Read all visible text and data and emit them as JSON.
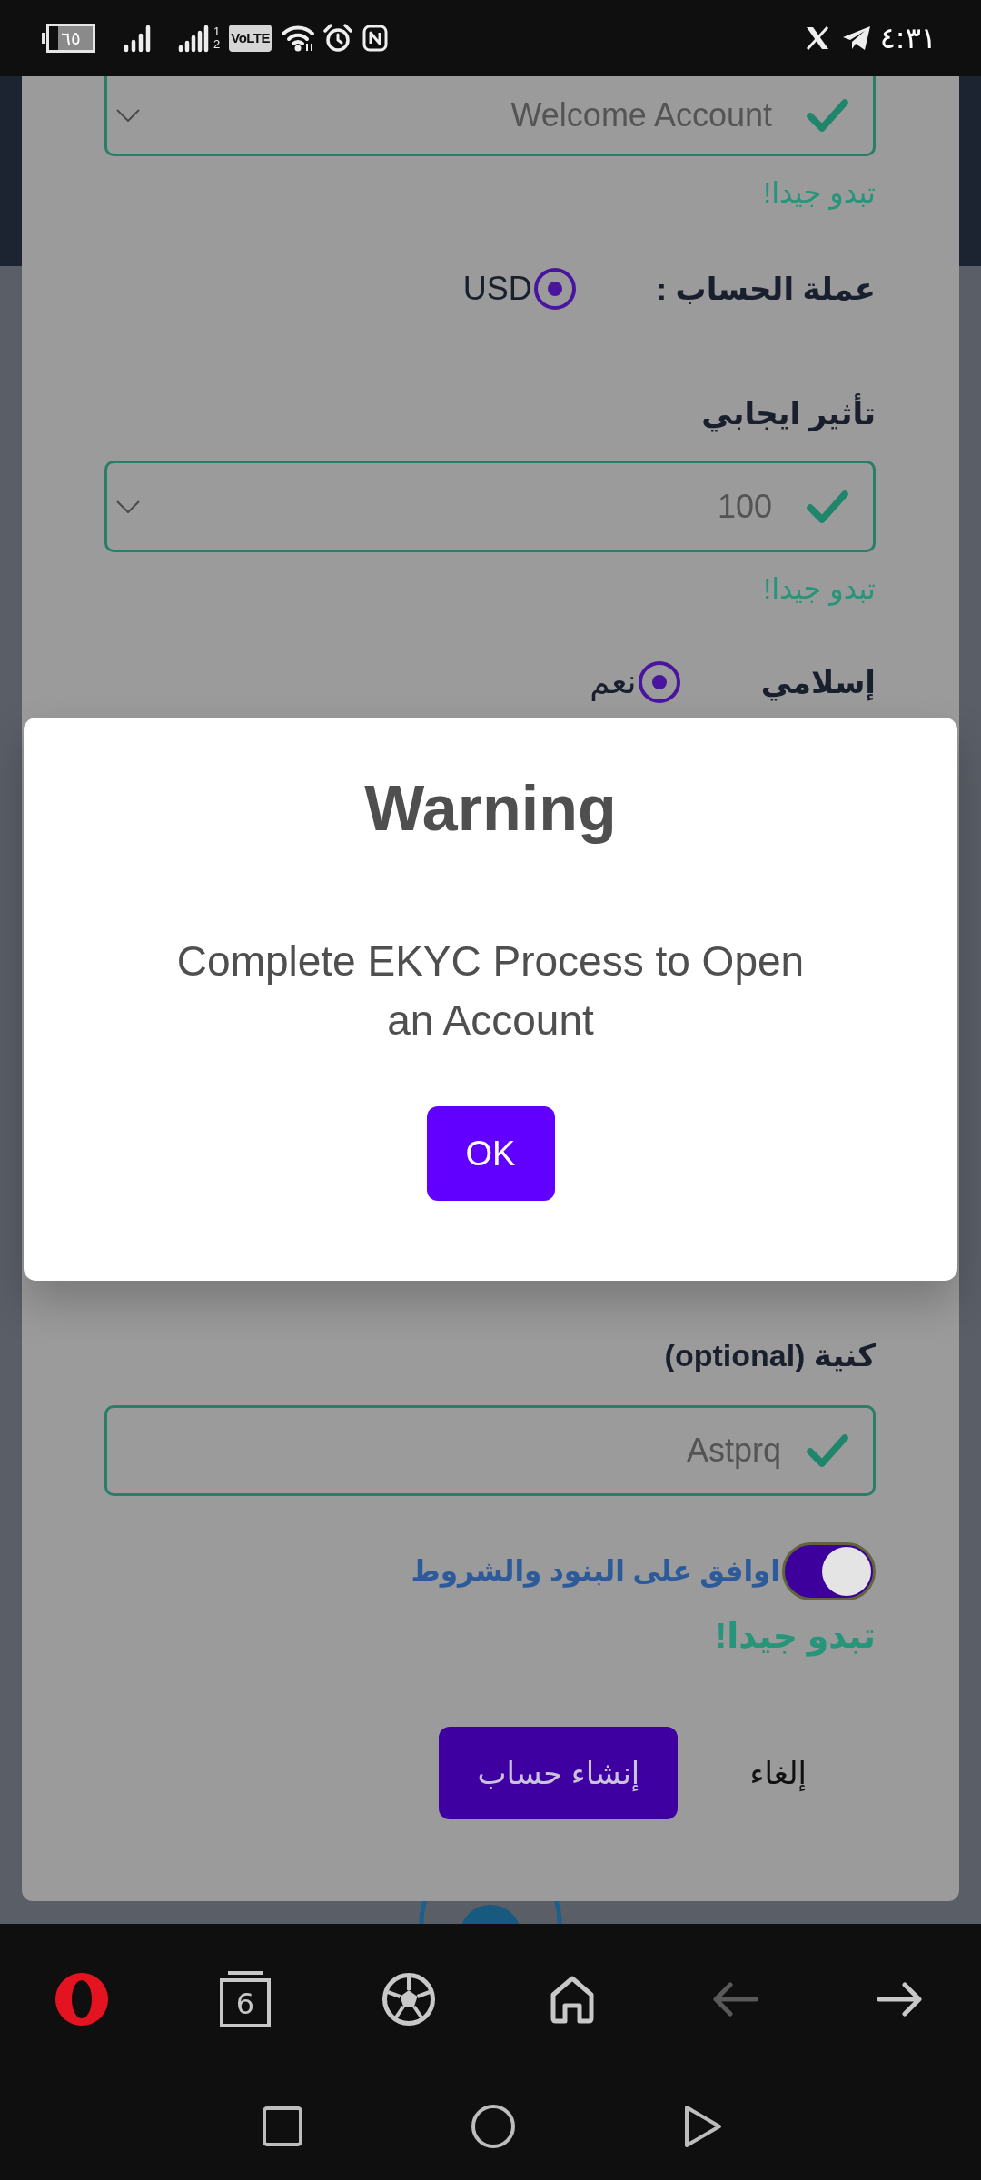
{
  "status_bar": {
    "battery": "٦٥",
    "sim_labels": [
      "1",
      "2"
    ],
    "network_badge": "VoLTE",
    "time": "٤:٣١"
  },
  "form": {
    "account_type": {
      "value": "Welcome Account",
      "valid": true,
      "hint": "تبدو جيدا!"
    },
    "currency": {
      "label": "عملة الحساب :",
      "options": [
        {
          "label": "USD",
          "selected": true
        }
      ]
    },
    "leverage": {
      "label": "تأثير ايجابي",
      "value": "100",
      "valid": true,
      "hint": "تبدو جيدا!"
    },
    "islamic": {
      "label": "إسلامي",
      "options": [
        {
          "label": "نعم",
          "selected": true
        }
      ]
    },
    "nickname": {
      "label": "كنية (optional)",
      "value": "Astprq",
      "valid": true
    },
    "terms": {
      "label": "اوافق على البنود والشروط",
      "on": true,
      "hint": "تبدو جيدا!"
    },
    "buttons": [
      {
        "label": "إلغاء",
        "kind": "text"
      },
      {
        "label": "إنشاء حساب",
        "kind": "primary"
      }
    ]
  },
  "dialog": {
    "title": "Warning",
    "message": "Complete EKYC Process to Open an Account",
    "button": "OK"
  },
  "browser_toolbar": {
    "items": [
      {
        "kind": "logo",
        "disabled": false
      },
      {
        "kind": "tabs",
        "count": "6",
        "disabled": false
      },
      {
        "kind": "ball",
        "disabled": false
      },
      {
        "kind": "home",
        "disabled": false
      },
      {
        "kind": "back",
        "disabled": true
      },
      {
        "kind": "forward",
        "disabled": false
      }
    ]
  }
}
